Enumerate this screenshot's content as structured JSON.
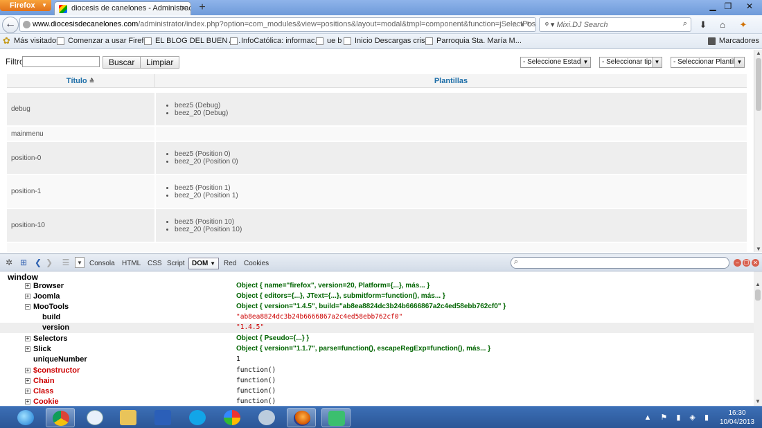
{
  "browser": {
    "menu_button": "Firefox",
    "tab_title": "diocesis de canelones - Administración",
    "url_host": "www.diocesisdecanelones.com",
    "url_path": "/administrator/index.php?option=com_modules&view=positions&layout=modal&tmpl=component&function=jSelectPositio",
    "search_placeholder": "Mixi.DJ Search",
    "bookmarks": [
      "Más visitados",
      "Comenzar a usar Firefox",
      "EL BLOG DEL BUEN A...",
      "InfoCatólica: informac...",
      "ue b",
      "Inicio Descargas cristo",
      "Parroquia Sta. María M..."
    ],
    "bookmarks_menu": "Marcadores"
  },
  "filter": {
    "label": "Filtro:",
    "value": "",
    "search_button": "Buscar",
    "clear_button": "Limpiar"
  },
  "selects": {
    "estado": "- Seleccione Estado -",
    "tipo": "- Seleccionar tipo -",
    "plantilla": "- Seleccionar Plantilla -"
  },
  "table": {
    "headers": {
      "title": "Título",
      "templates": "Plantillas"
    },
    "rows": [
      {
        "position": "debug",
        "templates": [
          "beez5 (Debug)",
          "beez_20 (Debug)"
        ]
      },
      {
        "position": "mainmenu",
        "templates": []
      },
      {
        "position": "position-0",
        "templates": [
          "beez5 (Position 0)",
          "beez_20 (Position 0)"
        ]
      },
      {
        "position": "position-1",
        "templates": [
          "beez5 (Position 1)",
          "beez_20 (Position 1)"
        ]
      },
      {
        "position": "position-10",
        "templates": [
          "beez5 (Position 10)",
          "beez_20 (Position 10)"
        ]
      }
    ]
  },
  "firebug": {
    "tabs": [
      "Consola",
      "HTML",
      "CSS",
      "Script",
      "DOM",
      "Red",
      "Cookies"
    ],
    "active_tab": "DOM",
    "root": "window",
    "rows": [
      {
        "key": "Browser",
        "value": "Object { name=\"firefox\", version=20, Platform={...}, más... }"
      },
      {
        "key": "Joomla",
        "value": "Object { editors={...}, JText={...}, submitform=function(), más... }"
      },
      {
        "key": "MooTools",
        "value": "Object { version=\"1.4.5\", build=\"ab8ea8824dc3b24b6666867a2c4ed58ebb762cf0\" }"
      },
      {
        "key": "build",
        "value": "\"ab8ea8824dc3b24b6666867a2c4ed58ebb762cf0\""
      },
      {
        "key": "version",
        "value": "\"1.4.5\""
      },
      {
        "key": "Selectors",
        "value": "Object { Pseudo={...} }"
      },
      {
        "key": "Slick",
        "value": "Object { version=\"1.1.7\", parse=function(), escapeRegExp=function(), más... }"
      },
      {
        "key": "uniqueNumber",
        "value": "1"
      },
      {
        "key": "$constructor",
        "value": "function()"
      },
      {
        "key": "Chain",
        "value": "function()"
      },
      {
        "key": "Class",
        "value": "function()"
      },
      {
        "key": "Cookie",
        "value": "function()"
      }
    ]
  },
  "taskbar": {
    "time": "16:30",
    "date": "10/04/2013"
  }
}
